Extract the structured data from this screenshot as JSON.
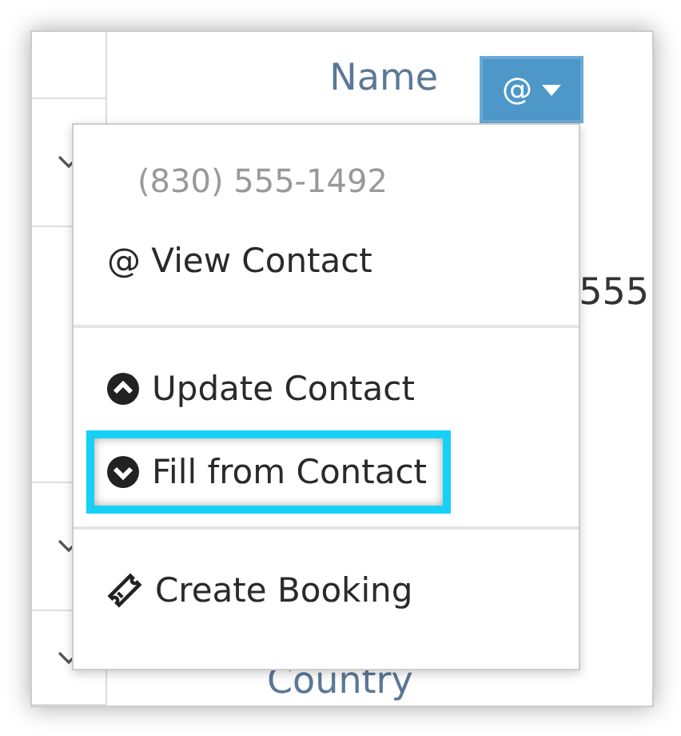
{
  "table": {
    "column_label": "Name",
    "cell_text": "555",
    "field_label": "Country"
  },
  "menu_button": {
    "label": "@"
  },
  "menu": {
    "phone": "(830) 555-1492",
    "groups": [
      [
        {
          "kind": "plain",
          "label": "@ View Contact",
          "highlighted": false
        }
      ],
      [
        {
          "kind": "up",
          "label": "Update Contact",
          "highlighted": false
        },
        {
          "kind": "down",
          "label": "Fill from Contact",
          "highlighted": true
        }
      ],
      [
        {
          "kind": "ticket",
          "label": "Create Booking",
          "highlighted": false
        }
      ]
    ]
  }
}
